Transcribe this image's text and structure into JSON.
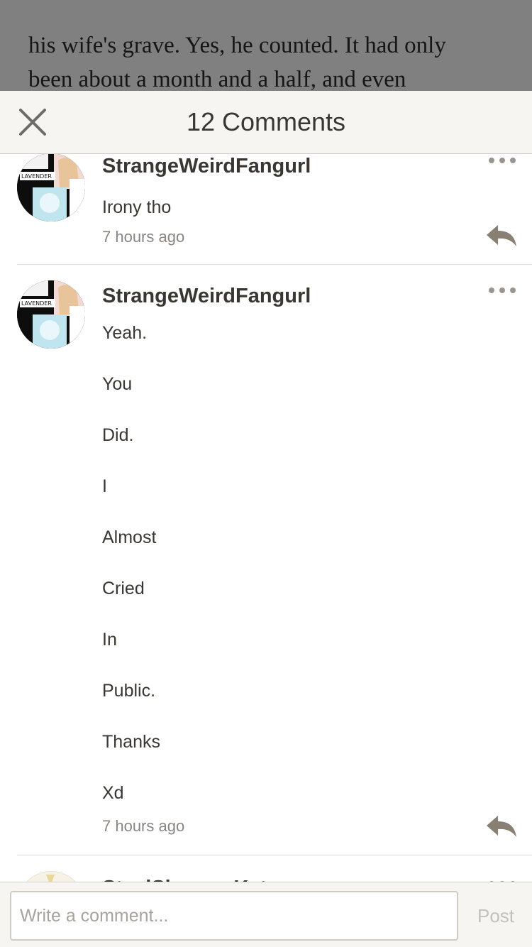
{
  "story": {
    "lines": [
      "his wife's grave. Yes, he counted. It had only",
      "been about a month and a half, and even"
    ]
  },
  "header": {
    "title": "12 Comments",
    "close_icon": "close-icon"
  },
  "comments": [
    {
      "author": "StrangeWeirdFangurl",
      "avatar_label_top": "LAVENDER",
      "body": [
        "Irony tho"
      ],
      "time": "7 hours ago"
    },
    {
      "author": "StrangeWeirdFangurl",
      "avatar_label_top": "LAVENDER",
      "body": [
        "Yeah.",
        "You",
        "Did.",
        "I",
        "Almost",
        "Cried",
        "In",
        "Public.",
        "Thanks",
        "Xd"
      ],
      "time": "7 hours ago"
    },
    {
      "author": "SteelShaggerKat",
      "body": [],
      "time": ""
    }
  ],
  "composer": {
    "placeholder": "Write a comment...",
    "post_label": "Post"
  },
  "colors": {
    "header_bg": "#f6f5f1",
    "text": "#3a3632",
    "muted": "#8a8580",
    "reply_icon": "#8a7f73"
  }
}
